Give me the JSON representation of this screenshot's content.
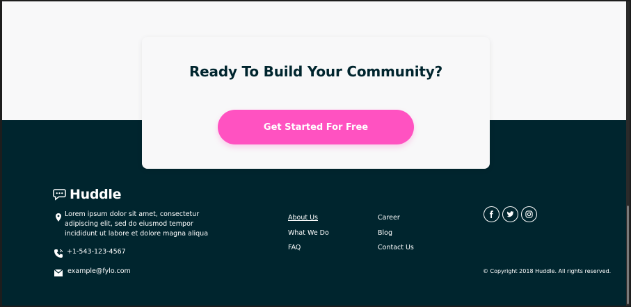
{
  "cta": {
    "title": "Ready To Build Your Community?",
    "button_label": "Get Started For Free"
  },
  "brand": {
    "name": "Huddle"
  },
  "contact": {
    "address": "Lorem ipsum dolor sit amet, consectetur adipiscing elit, sed do eiusmod tempor incididunt ut labore et dolore magna aliqua",
    "phone": "+1-543-123-4567",
    "email": "example@fylo.com"
  },
  "links": {
    "about": "About Us",
    "what_we_do": "What We Do",
    "faq": "FAQ",
    "career": "Career",
    "blog": "Blog",
    "contact_us": "Contact Us"
  },
  "social": [
    "facebook-icon",
    "twitter-icon",
    "instagram-icon"
  ],
  "copyright": "© Copyright 2018 Huddle. All rights reserved.",
  "colors": {
    "footer_bg": "#00252e",
    "page_bg": "#f8f8f9",
    "accent": "#ff52c1",
    "heading": "#00252e"
  }
}
